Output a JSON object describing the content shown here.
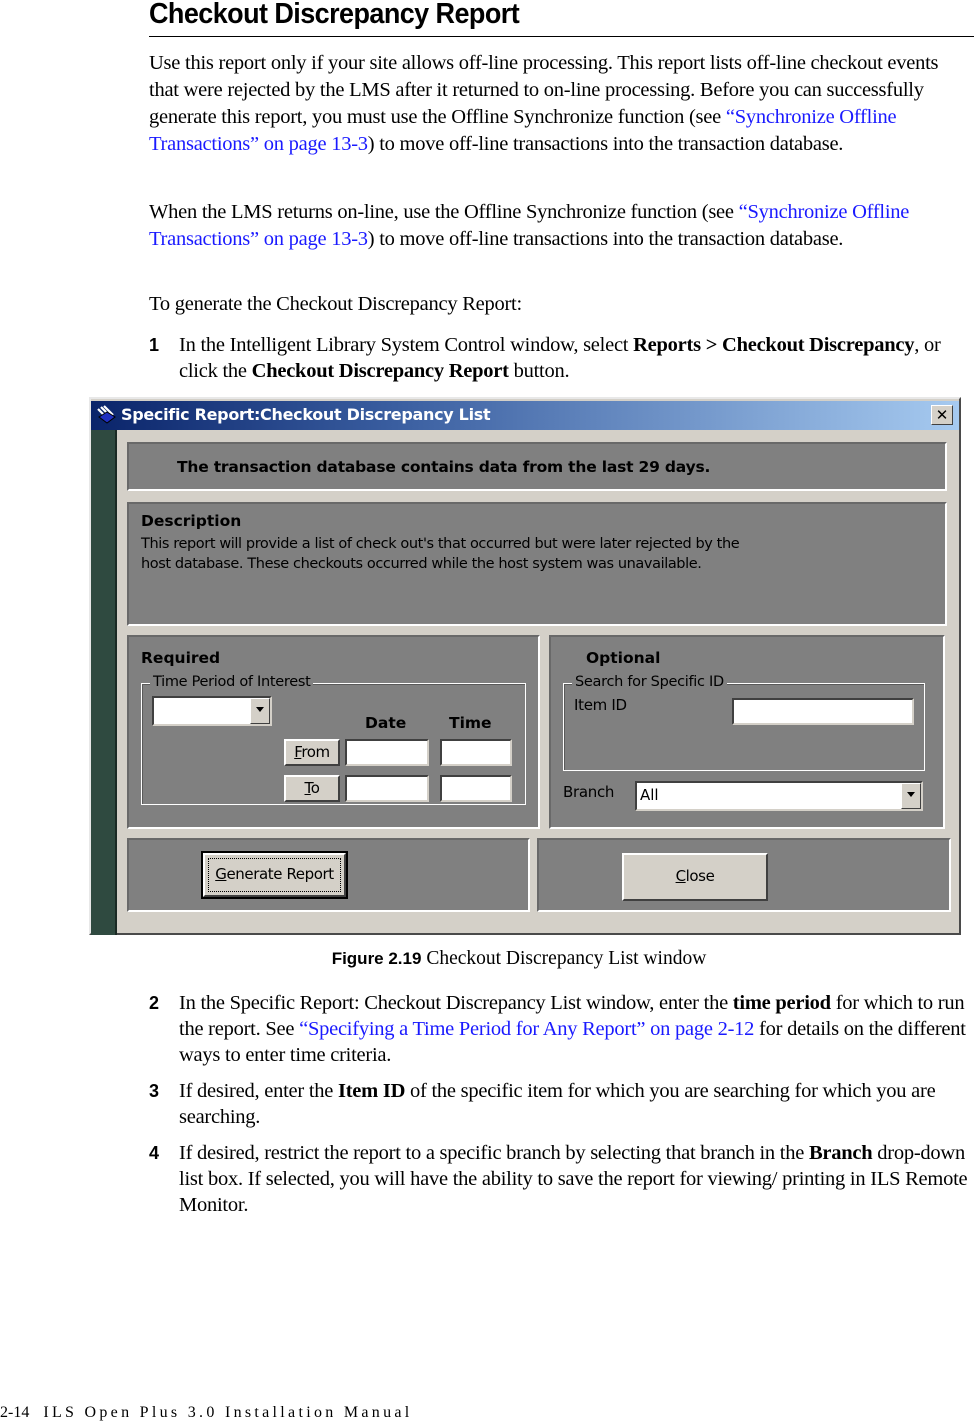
{
  "document": {
    "title": "Checkout Discrepancy Report",
    "intro": {
      "text_before_link": "Use this report only if your site allows off-line processing. This report lists off-line checkout events that were rejected by the LMS after it returned to on-line processing. Before you can successfully generate this report, you must use the Offline Synchronize function (see ",
      "link": "“Synchronize Offline Transactions” on page 13-3",
      "text_after_link": ") to move off-line transactions into the transaction database."
    },
    "para2": {
      "text_before_link": "When the LMS returns on-line, use the Offline Synchronize function (see ",
      "link": "“Synchronize Offline Transactions” on page 13-3",
      "text_after_link": ") to move off-line transactions into the transaction database."
    },
    "para3": "To generate the Checkout Discrepancy Report:",
    "steps": [
      {
        "number": "1",
        "parts": [
          "In the Intelligent Library System Control window, select ",
          "Reports > Checkout Discrepancy",
          ", or click the ",
          "Checkout Discrepancy Report",
          " button."
        ]
      },
      {
        "number": "2",
        "parts": [
          "In the Specific Report: Checkout Discrepancy List window, enter the ",
          "time period",
          " for which to run the report. See ",
          "“Specifying a Time Period for Any Report” on page 2-12",
          " for details on the different ways to enter time criteria."
        ]
      },
      {
        "number": "3",
        "parts": [
          "If desired, enter the ",
          "Item ID",
          " of the specific item for which you are searching for which you are searching."
        ]
      },
      {
        "number": "4",
        "parts": [
          "If desired, restrict the report to a specific branch by selecting that branch in the ",
          "Branch",
          " drop-down list box. If selected, you will have the ability to save the report for viewing/ printing in ILS Remote Monitor."
        ]
      }
    ],
    "figure_caption": {
      "label": "Figure 2.19",
      "text": " Checkout Discrepancy List window"
    },
    "footer": {
      "page_number": "2-14",
      "manual_title": "ILS Open Plus 3.0 Installation Manual"
    },
    "colors": {
      "link": "#1a1aff",
      "titlebar_start": "#0a246a",
      "titlebar_end": "#a6caf0",
      "panel": "#808080",
      "dialog_face": "#d4d0c8",
      "side_strip": "#2f4a40"
    }
  },
  "window": {
    "title": "Specific Report:Checkout Discrepancy List",
    "close_icon": "close-x",
    "info_message": "The transaction database contains data from the last 29 days.",
    "description": {
      "heading": "Description",
      "body_line1": "This report will provide a list of check out's that occurred but were later rejected by the",
      "body_line2": "host database.  These checkouts occurred while the host system was unavailable."
    },
    "required": {
      "heading": "Required",
      "group_label": "Time Period of Interest",
      "period_select_value": "",
      "date_header": "Date",
      "time_header": "Time",
      "from_button": {
        "accel": "F",
        "rest": "rom"
      },
      "to_button": {
        "accel": "T",
        "rest": "o"
      },
      "from_date": "",
      "from_time": "",
      "to_date": "",
      "to_time": ""
    },
    "optional": {
      "heading": "Optional",
      "group_label": "Search for Specific ID",
      "item_id_label": "Item ID",
      "item_id_value": "",
      "branch_label": "Branch",
      "branch_value": "All"
    },
    "buttons": {
      "generate": {
        "accel": "G",
        "rest": "enerate Report"
      },
      "close": {
        "accel": "C",
        "rest": "lose"
      }
    }
  }
}
